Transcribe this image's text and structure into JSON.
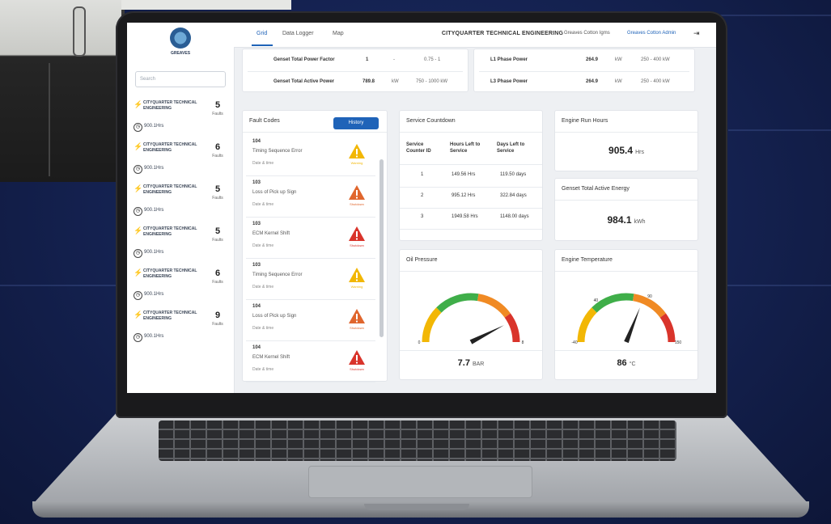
{
  "sidebar": {
    "search_placeholder": "Search",
    "units": [
      {
        "name": "CITYQUARTER TECHNICAL ENGINEERING",
        "count": "5",
        "faults_label": "Faults",
        "hours": "900.1Hrs"
      },
      {
        "name": "CITYQUARTER TECHNICAL ENGINEERING",
        "count": "6",
        "faults_label": "Faults",
        "hours": "900.1Hrs"
      },
      {
        "name": "CITYQUARTER TECHNICAL ENGINEERING",
        "count": "5",
        "faults_label": "Faults",
        "hours": "900.1Hrs"
      },
      {
        "name": "CITYQUARTER TECHNICAL ENGINEERING",
        "count": "5",
        "faults_label": "Faults",
        "hours": "900.1Hrs"
      },
      {
        "name": "CITYQUARTER TECHNICAL ENGINEERING",
        "count": "6",
        "faults_label": "Faults",
        "hours": "900.1Hrs"
      },
      {
        "name": "CITYQUARTER TECHNICAL ENGINEERING",
        "count": "9",
        "faults_label": "Faults",
        "hours": "900.1Hrs"
      }
    ]
  },
  "topbar": {
    "tabs": [
      "Grid",
      "Data Logger",
      "Map"
    ],
    "title": "CITYQUARTER TECHNICAL ENGINEERING",
    "user_links": [
      "Greaves Cotton Igms",
      "Greaves Cotton Admin"
    ],
    "logout_glyph": "⇥"
  },
  "metrics": {
    "rows_left": [
      {
        "label": "Genset Total Power Factor",
        "value": "1",
        "unit": "-",
        "range": "0.75 - 1"
      },
      {
        "label": "Genset Total Active Power",
        "value": "789.8",
        "unit": "kW",
        "range": "750 - 1000 kW"
      }
    ],
    "rows_right": [
      {
        "label": "L1 Phase Power",
        "value": "264.9",
        "unit": "kW",
        "range": "250 - 400 kW"
      },
      {
        "label": "L3 Phase Power",
        "value": "264.9",
        "unit": "kW",
        "range": "250 - 400 kW"
      }
    ]
  },
  "fault_codes": {
    "title": "Fault Codes",
    "button": "History",
    "items": [
      {
        "code": "104",
        "desc": "Timing Sequence Error",
        "date": "Date & time",
        "severity": "Warning",
        "color": "#f2b705"
      },
      {
        "code": "103",
        "desc": "Loss of Pick up Sign",
        "date": "Date & time",
        "severity": "Shutdown",
        "color": "#e0662d"
      },
      {
        "code": "103",
        "desc": "ECM Kernel Shift",
        "date": "Date & time",
        "severity": "Shutdown",
        "color": "#d9342b"
      },
      {
        "code": "103",
        "desc": "Timing Sequence Error",
        "date": "Date & time",
        "severity": "Warning",
        "color": "#f2b705"
      },
      {
        "code": "104",
        "desc": "Loss of Pick up Sign",
        "date": "Date & time",
        "severity": "Shutdown",
        "color": "#e0662d"
      },
      {
        "code": "104",
        "desc": "ECM Kernel Shift",
        "date": "Date & time",
        "severity": "Shutdown",
        "color": "#d9342b"
      }
    ]
  },
  "service_countdown": {
    "title": "Service Countdown",
    "headers": [
      "Service Counter ID",
      "Hours Left to Service",
      "Days Left to Service"
    ],
    "rows": [
      [
        "1",
        "149.56 Hrs",
        "119.50 days"
      ],
      [
        "2",
        "995.12 Hrs",
        "322.84 days"
      ],
      [
        "3",
        "1949.58 Hrs",
        "1148.00 days"
      ]
    ]
  },
  "engine_run_hours": {
    "title": "Engine Run Hours",
    "value": "905.4",
    "unit": "Hrs"
  },
  "genset_energy": {
    "title": "Genset Total Active Energy",
    "value": "984.1",
    "unit": "kWh"
  },
  "oil_pressure": {
    "title": "Oil Pressure",
    "value": "7.7",
    "unit": "BAR",
    "min_label": "0",
    "max_label": "8",
    "level": 0.85
  },
  "engine_temperature": {
    "title": "Engine Temperature",
    "value": "86",
    "unit": "°C",
    "min_label": "-40",
    "max_label": "150",
    "mark1": "40",
    "mark2": "90",
    "level": 0.62
  },
  "colors": {
    "accent": "#1f63b8",
    "gauge_yellow": "#f2b705",
    "gauge_green": "#3fae49",
    "gauge_orange": "#f08a24",
    "gauge_red": "#d9342b"
  }
}
